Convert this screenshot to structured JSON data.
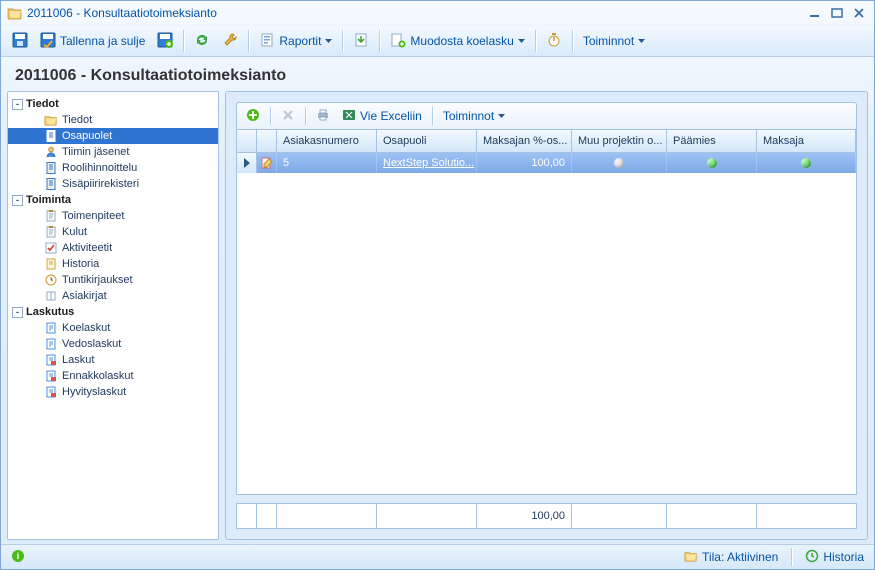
{
  "window": {
    "title": "2011006 - Konsultaatiotoimeksianto",
    "icon": "folder-open-icon"
  },
  "toolbar": {
    "save_and_close": "Tallenna ja sulje",
    "reports": "Raportit",
    "reports_icon": "report-icon",
    "create_test_invoice": "Muodosta koelasku",
    "actions": "Toiminnot"
  },
  "header": {
    "title": "2011006 - Konsultaatiotoimeksianto"
  },
  "tree": {
    "groups": [
      {
        "key": "tiedot",
        "label": "Tiedot",
        "items": [
          {
            "key": "tiedot_item",
            "label": "Tiedot",
            "icon": "folder-open-icon"
          },
          {
            "key": "osapuolet",
            "label": "Osapuolet",
            "icon": "doc-icon",
            "selected": true
          },
          {
            "key": "tiimin_jasenet",
            "label": "Tiimin jäsenet",
            "icon": "person-icon"
          },
          {
            "key": "roolihinnoittelu",
            "label": "Roolihinnoittelu",
            "icon": "doc-icon"
          },
          {
            "key": "sisapiirirekisteri",
            "label": "Sisäpiirirekisteri",
            "icon": "doc-icon"
          }
        ]
      },
      {
        "key": "toiminta",
        "label": "Toiminta",
        "items": [
          {
            "key": "toimenpiteet",
            "label": "Toimenpiteet",
            "icon": "clipboard-icon"
          },
          {
            "key": "kulut",
            "label": "Kulut",
            "icon": "clipboard-icon"
          },
          {
            "key": "aktiviteetit",
            "label": "Aktiviteetit",
            "icon": "check-icon"
          },
          {
            "key": "historia",
            "label": "Historia",
            "icon": "scroll-icon"
          },
          {
            "key": "tuntikirjaukset",
            "label": "Tuntikirjaukset",
            "icon": "clock-icon"
          },
          {
            "key": "asiakirjat",
            "label": "Asiakirjat",
            "icon": "book-icon"
          }
        ]
      },
      {
        "key": "laskutus",
        "label": "Laskutus",
        "items": [
          {
            "key": "koelaskut",
            "label": "Koelaskut",
            "icon": "invoice-icon"
          },
          {
            "key": "vedoslaskut",
            "label": "Vedoslaskut",
            "icon": "invoice-icon"
          },
          {
            "key": "laskut",
            "label": "Laskut",
            "icon": "invoice-red-icon"
          },
          {
            "key": "ennakkolaskut",
            "label": "Ennakkolaskut",
            "icon": "invoice-red-icon"
          },
          {
            "key": "hyvityslaskut",
            "label": "Hyvityslaskut",
            "icon": "invoice-red-icon"
          }
        ]
      }
    ]
  },
  "inner_toolbar": {
    "export_excel": "Vie Exceliin",
    "actions": "Toiminnot"
  },
  "grid": {
    "columns": {
      "asiakasnumero": "Asiakasnumero",
      "osapuoli": "Osapuoli",
      "maksajan_pct": "Maksajan %-os...",
      "muu_projektin": "Muu projektin o...",
      "paamies": "Päämies",
      "maksaja": "Maksaja"
    },
    "rows": [
      {
        "asiakasnumero": "5",
        "osapuoli": "NextStep Solutio...",
        "maksajan_pct": "100,00",
        "muu_projektin": "gray",
        "paamies": "green",
        "maksaja": "green"
      }
    ],
    "summary": {
      "maksajan_pct_total": "100,00"
    }
  },
  "statusbar": {
    "status_label": "Tila: Aktiivinen",
    "history": "Historia"
  }
}
